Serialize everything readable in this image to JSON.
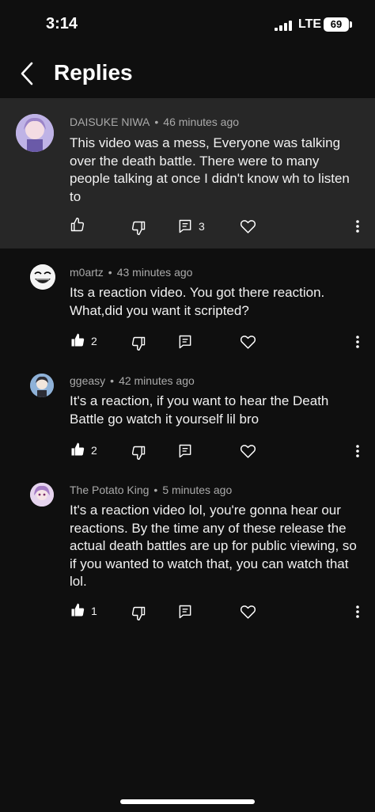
{
  "status": {
    "time": "3:14",
    "network": "LTE",
    "battery": "69"
  },
  "header": {
    "title": "Replies"
  },
  "parent": {
    "author": "DAISUKE NIWA",
    "time": "46 minutes ago",
    "text": "This video was a mess, Everyone was talking over the death battle. There were to many people talking at once I didn't know wh to listen to",
    "reply_count": "3"
  },
  "replies": [
    {
      "author": "m0artz",
      "time": "43 minutes ago",
      "text": "Its a reaction video. You got there reaction. What,did you want it scripted?",
      "likes": "2"
    },
    {
      "author": "ggeasy",
      "time": "42 minutes ago",
      "text": "It's a reaction, if you want to hear the Death Battle go watch it yourself lil bro",
      "likes": "2"
    },
    {
      "author": "The Potato King",
      "time": "5 minutes ago",
      "text": "It's a reaction video lol, you're gonna hear our reactions. By the time any of these release the actual death battles are up for public viewing, so if you wanted to watch that, you can watch that lol.",
      "likes": "1"
    }
  ],
  "separator": "•",
  "icons": [
    "back-chevron-icon",
    "thumbs-up-icon",
    "thumbs-down-icon",
    "comment-icon",
    "heart-icon",
    "more-vertical-icon"
  ]
}
